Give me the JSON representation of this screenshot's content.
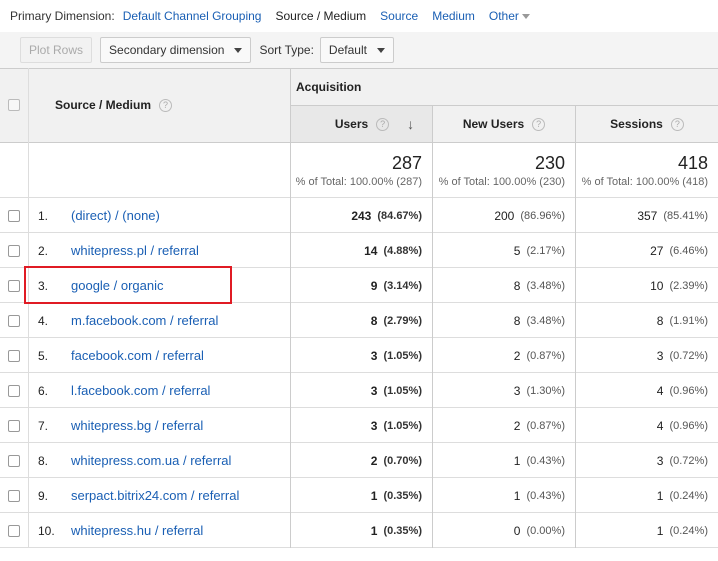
{
  "dimension_bar": {
    "label": "Primary Dimension:",
    "options": [
      "Default Channel Grouping",
      "Source / Medium",
      "Source",
      "Medium",
      "Other"
    ],
    "active": "Source / Medium"
  },
  "toolbar": {
    "plot_rows": "Plot Rows",
    "secondary_dimension": "Secondary dimension",
    "sort_type_label": "Sort Type:",
    "sort_type_value": "Default"
  },
  "table": {
    "group_header": "Acquisition",
    "dim_header": "Source / Medium",
    "columns": [
      "Users",
      "New Users",
      "Sessions"
    ],
    "totals": [
      {
        "value": "287",
        "sub": "% of Total: 100.00% (287)"
      },
      {
        "value": "230",
        "sub": "% of Total: 100.00% (230)"
      },
      {
        "value": "418",
        "sub": "% of Total: 100.00% (418)"
      }
    ],
    "rows": [
      {
        "rank": "1.",
        "source": "(direct) / (none)",
        "users": "243",
        "users_pct": "(84.67%)",
        "new_users": "200",
        "new_users_pct": "(86.96%)",
        "sessions": "357",
        "sessions_pct": "(85.41%)"
      },
      {
        "rank": "2.",
        "source": "whitepress.pl / referral",
        "users": "14",
        "users_pct": "(4.88%)",
        "new_users": "5",
        "new_users_pct": "(2.17%)",
        "sessions": "27",
        "sessions_pct": "(6.46%)"
      },
      {
        "rank": "3.",
        "source": "google / organic",
        "users": "9",
        "users_pct": "(3.14%)",
        "new_users": "8",
        "new_users_pct": "(3.48%)",
        "sessions": "10",
        "sessions_pct": "(2.39%)"
      },
      {
        "rank": "4.",
        "source": "m.facebook.com / referral",
        "users": "8",
        "users_pct": "(2.79%)",
        "new_users": "8",
        "new_users_pct": "(3.48%)",
        "sessions": "8",
        "sessions_pct": "(1.91%)"
      },
      {
        "rank": "5.",
        "source": "facebook.com / referral",
        "users": "3",
        "users_pct": "(1.05%)",
        "new_users": "2",
        "new_users_pct": "(0.87%)",
        "sessions": "3",
        "sessions_pct": "(0.72%)"
      },
      {
        "rank": "6.",
        "source": "l.facebook.com / referral",
        "users": "3",
        "users_pct": "(1.05%)",
        "new_users": "3",
        "new_users_pct": "(1.30%)",
        "sessions": "4",
        "sessions_pct": "(0.96%)"
      },
      {
        "rank": "7.",
        "source": "whitepress.bg / referral",
        "users": "3",
        "users_pct": "(1.05%)",
        "new_users": "2",
        "new_users_pct": "(0.87%)",
        "sessions": "4",
        "sessions_pct": "(0.96%)"
      },
      {
        "rank": "8.",
        "source": "whitepress.com.ua / referral",
        "users": "2",
        "users_pct": "(0.70%)",
        "new_users": "1",
        "new_users_pct": "(0.43%)",
        "sessions": "3",
        "sessions_pct": "(0.72%)"
      },
      {
        "rank": "9.",
        "source": "serpact.bitrix24.com / referral",
        "users": "1",
        "users_pct": "(0.35%)",
        "new_users": "1",
        "new_users_pct": "(0.43%)",
        "sessions": "1",
        "sessions_pct": "(0.24%)"
      },
      {
        "rank": "10.",
        "source": "whitepress.hu / referral",
        "users": "1",
        "users_pct": "(0.35%)",
        "new_users": "0",
        "new_users_pct": "(0.00%)",
        "sessions": "1",
        "sessions_pct": "(0.24%)"
      }
    ]
  },
  "colors": {
    "link": "#1a5fb4",
    "highlight": "#e01b24"
  }
}
